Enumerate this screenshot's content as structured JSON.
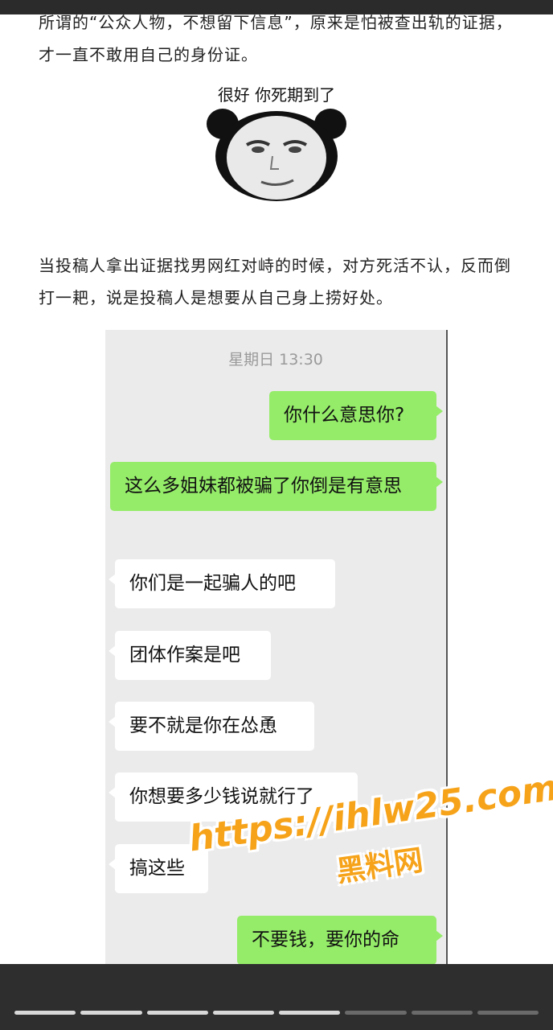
{
  "article": {
    "paragraph1": "所谓的“公众人物，不想留下信息”，原来是怕被查出轨的证据，才一直不敢用自己的身份证。",
    "meme_caption": "很好 你死期到了",
    "paragraph2": "当投稿人拿出证据找男网红对峙的时候，对方死活不认，反而倒打一耙，说是投稿人是想要从自己身上捞好处。"
  },
  "chat": {
    "timestamp": "星期日 13:30",
    "messages": [
      {
        "side": "right",
        "text": "你什么意思你?"
      },
      {
        "side": "right",
        "text": "这么多姐妹都被骗了你倒是有意思"
      },
      {
        "side": "left",
        "text": "你们是一起骗人的吧"
      },
      {
        "side": "left",
        "text": "团体作案是吧"
      },
      {
        "side": "left",
        "text": "要不就是你在怂恿"
      },
      {
        "side": "left",
        "text": "你想要多少钱说就行了"
      },
      {
        "side": "left",
        "text": "搞这些"
      },
      {
        "side": "right",
        "text": "不要钱，要你的命"
      }
    ]
  },
  "watermark": {
    "url": "https://ihlw25.com",
    "name": "黑料网"
  },
  "progress": {
    "segments_total": 8,
    "segments_completed": 5
  },
  "colors": {
    "right_bubble": "#95ec69",
    "left_bubble": "#ffffff",
    "chat_background": "#ebebeb",
    "watermark": "#f6a31a"
  }
}
